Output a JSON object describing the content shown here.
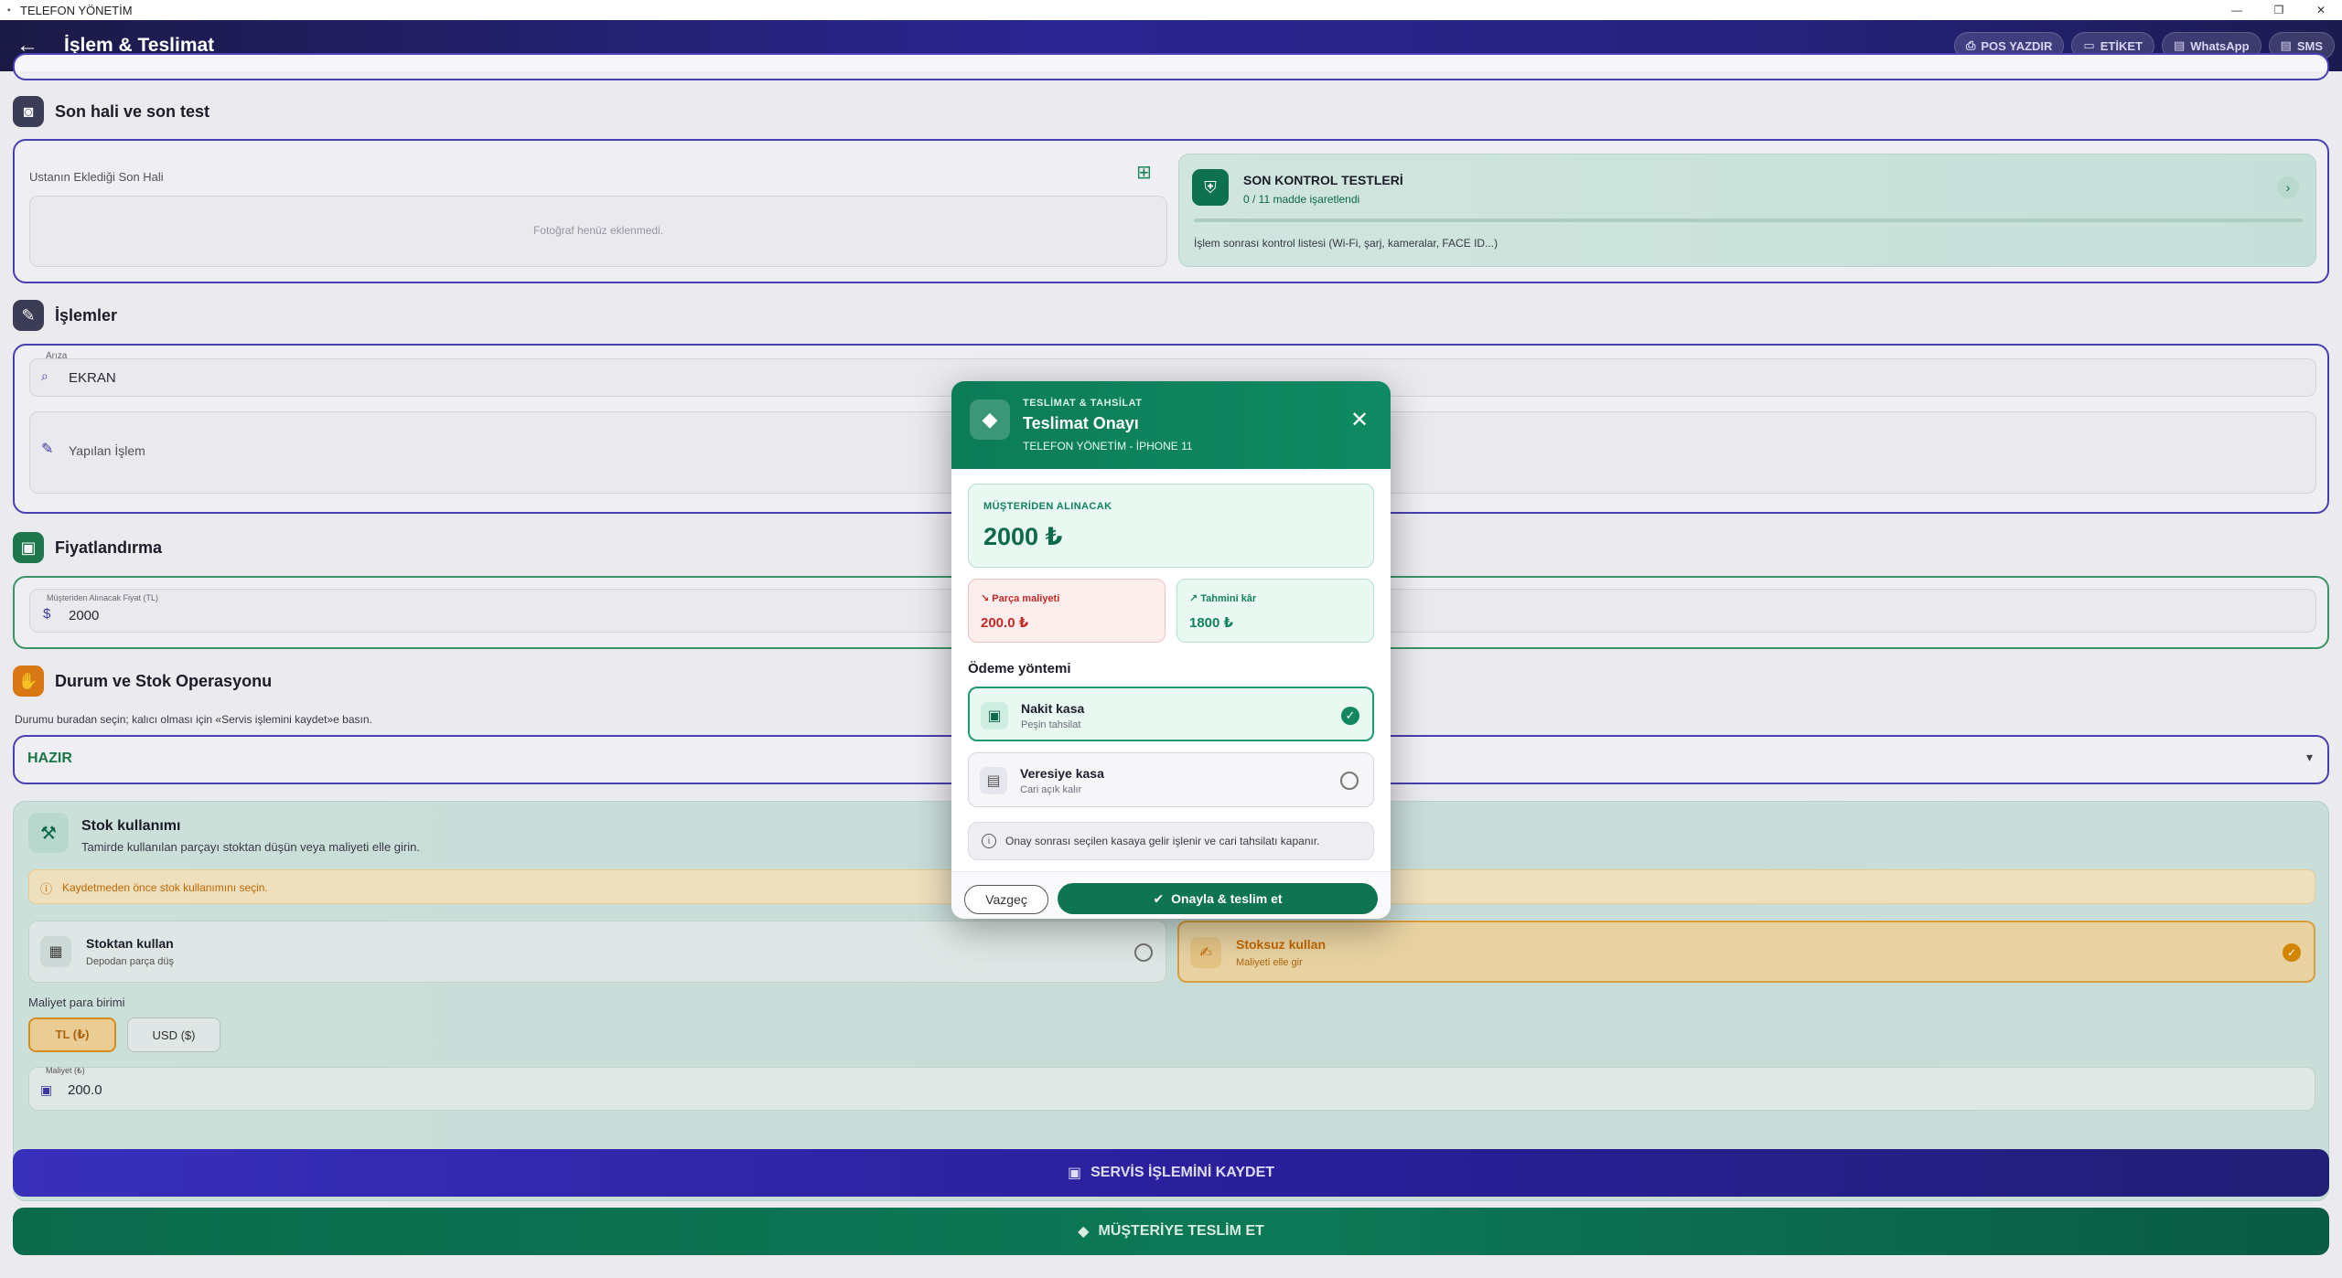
{
  "window": {
    "title": "TELEFON YÖNETİM",
    "controls": [
      "—",
      "❐",
      "✕"
    ]
  },
  "appbar": {
    "title": "İşlem & Teslimat",
    "actions": {
      "pos": "POS YAZDIR",
      "label": "ETİKET",
      "whatsapp": "WhatsApp",
      "sms": "SMS"
    }
  },
  "final_state": {
    "title": "Son hali ve son test",
    "photo_label": "Ustanın Eklediği Son Hali",
    "photo_empty": "Fotoğraf henüz eklenmedi.",
    "checks_title": "SON KONTROL TESTLERİ",
    "checks_count": "0 / 11 madde işaretlendi",
    "checks_desc": "İşlem sonrası kontrol listesi (Wi-Fi, şarj, kameralar, FACE ID...)"
  },
  "operations": {
    "title": "İşlemler",
    "fault_label": "Arıza",
    "fault_value": "EKRAN",
    "done_placeholder": "Yapılan İşlem"
  },
  "pricing": {
    "title": "Fiyatlandırma",
    "price_label": "Müşteriden Alınacak Fiyat (TL)",
    "price_value": "2000"
  },
  "status": {
    "title": "Durum ve Stok Operasyonu",
    "hint": "Durumu buradan seçin; kalıcı olması için «Servis işlemini kaydet»e basın.",
    "selected": "HAZIR"
  },
  "stock": {
    "title": "Stok kullanımı",
    "desc": "Tamirde kullanılan parçayı stoktan düşün veya maliyeti elle girin.",
    "warning": "Kaydetmeden önce stok kullanımını seçin.",
    "opt1_title": "Stoktan kullan",
    "opt1_sub": "Depodan parça düş",
    "opt2_title": "Stoksuz kullan",
    "opt2_sub": "Maliyeti elle gir",
    "currency_label": "Maliyet para birimi",
    "currency_tl": "TL (₺)",
    "currency_usd": "USD ($)",
    "cost_label": "Maliyet (₺)",
    "cost_value": "200.0"
  },
  "buttons": {
    "save": "SERVİS İŞLEMİNİ KAYDET",
    "deliver": "MÜŞTERİYE TESLİM ET"
  },
  "modal": {
    "kicker": "TESLİMAT & TAHSİLAT",
    "title": "Teslimat Onayı",
    "subtitle": "TELEFON YÖNETİM - İPHONE 11",
    "amount_caption": "MÜŞTERİDEN ALINACAK",
    "amount_value": "2000 ₺",
    "cost_caption": "Parça maliyeti",
    "cost_value": "200.0 ₺",
    "profit_caption": "Tahmini kâr",
    "profit_value": "1800 ₺",
    "payment_title": "Ödeme yöntemi",
    "pay1_title": "Nakit kasa",
    "pay1_sub": "Peşin tahsilat",
    "pay2_title": "Veresiye kasa",
    "pay2_sub": "Cari açık kalır",
    "info": "Onay sonrası seçilen kasaya gelir işlenir ve cari tahsilatı kapanır.",
    "cancel": "Vazgeç",
    "confirm": "Onayla & teslim et"
  },
  "colors": {
    "primary": "#2a2592",
    "success": "#0e7452",
    "danger": "#c62828",
    "warning": "#d98a00"
  }
}
